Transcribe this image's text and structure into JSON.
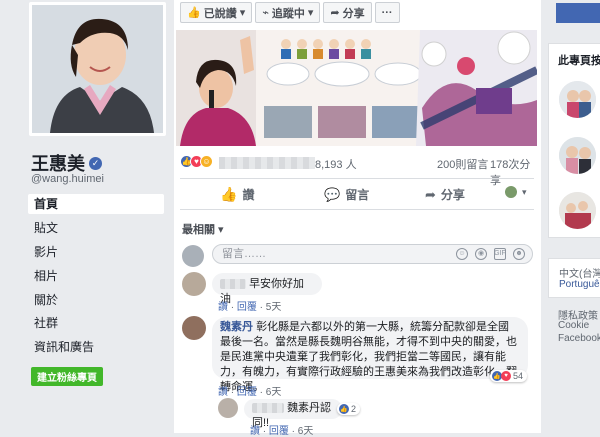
{
  "profile": {
    "name": "王惠美",
    "handle": "@wang.huimei",
    "nav": [
      "首頁",
      "貼文",
      "影片",
      "相片",
      "關於",
      "社群",
      "資訊和廣告"
    ],
    "create_button": "建立粉絲專頁"
  },
  "toolbar": {
    "liked": "已說讚",
    "following": "追蹤中",
    "share": "分享",
    "more": "···"
  },
  "post": {
    "reaction_count": "8,193 人",
    "comment_count": "200則留言",
    "share_count": "178次分享",
    "actions": {
      "like": "讚",
      "comment": "留言",
      "share": "分享"
    },
    "sort_label": "最相關 ▾",
    "comment_placeholder": "留言……"
  },
  "comments": [
    {
      "text": "早安你好加油",
      "like": "讚",
      "reply": "回覆",
      "time": "5天"
    },
    {
      "author": "魏素丹",
      "text": "彰化縣是六都以外的第一大縣，統籌分配款卻是全國最後一名。當然是縣長魏明谷無能，才得不到中央的關愛，也是民進黨中央遺棄了我們彰化，我們拒當二等國民，讓有能力，有魄力，有實際行政經驗的王惠美來為我們改造彰化，翻轉命運。",
      "reaction_count": "54",
      "like": "讚",
      "reply": "回覆",
      "time": "6天"
    },
    {
      "text": "魏素丹認同!!",
      "reaction_count": "2",
      "like": "讚",
      "reply": "回覆",
      "time": "6天"
    }
  ],
  "right": {
    "pages_title": "此專頁按讚",
    "language": "中文(台灣)",
    "language_alt": "Português",
    "footer": [
      "隱私政策",
      "Cookie",
      "Facebook"
    ]
  },
  "colors": {
    "fb_blue": "#4267b2",
    "link": "#385898",
    "green": "#42b72a",
    "bg": "#e9ebee"
  }
}
